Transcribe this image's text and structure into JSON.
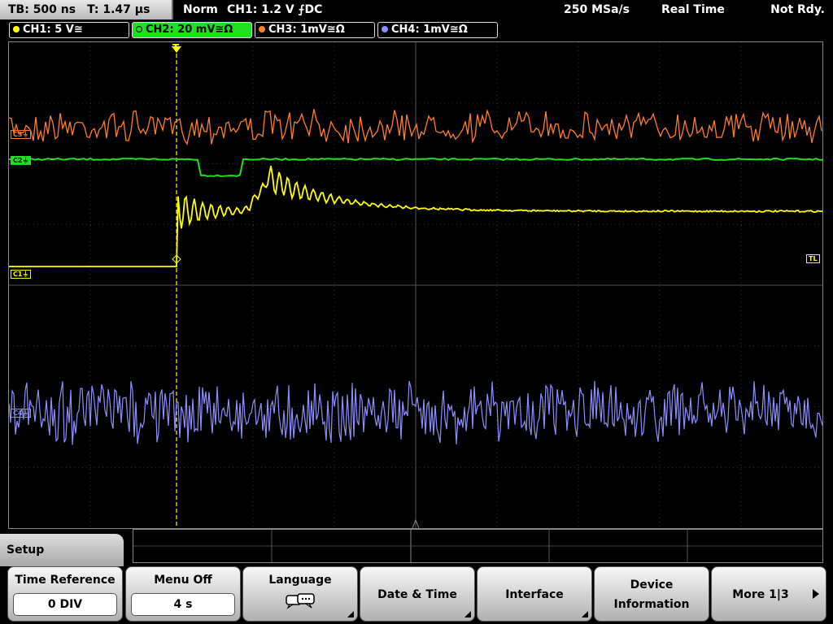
{
  "status": {
    "timebase": "TB: 500 ns",
    "trigger_time": "T: 1.47 µs",
    "acq_mode": "Norm",
    "trigger_info": "CH1: 1.2 V ⨍DC",
    "sample_rate": "250 MSa/s",
    "mode": "Real Time",
    "state": "Not Rdy."
  },
  "channels": [
    {
      "label": "CH1: 5 V≅",
      "color": "#ffff00",
      "marker": "C1"
    },
    {
      "label": "CH2: 20 mV≅Ω",
      "color": "#1fe01f",
      "marker": "C2"
    },
    {
      "label": "CH3: 1mV≅Ω",
      "color": "#ff7f2a",
      "marker": "C3"
    },
    {
      "label": "CH4: 1mV≅Ω",
      "color": "#8f8fff",
      "marker": "C4"
    }
  ],
  "trigger_level_marker": "TL",
  "trigger_position_marker": "T",
  "menu": {
    "title": "Setup",
    "softkeys": [
      {
        "label": "Time Reference",
        "value": "0 DIV"
      },
      {
        "label": "Menu Off",
        "value": "4 s"
      },
      {
        "label": "Language",
        "icon": "speech-bubble-icon"
      },
      {
        "label": "Date & Time"
      },
      {
        "label": "Interface"
      },
      {
        "line1": "Device",
        "line2": "Information"
      },
      {
        "label": "More 1|3"
      }
    ]
  }
}
